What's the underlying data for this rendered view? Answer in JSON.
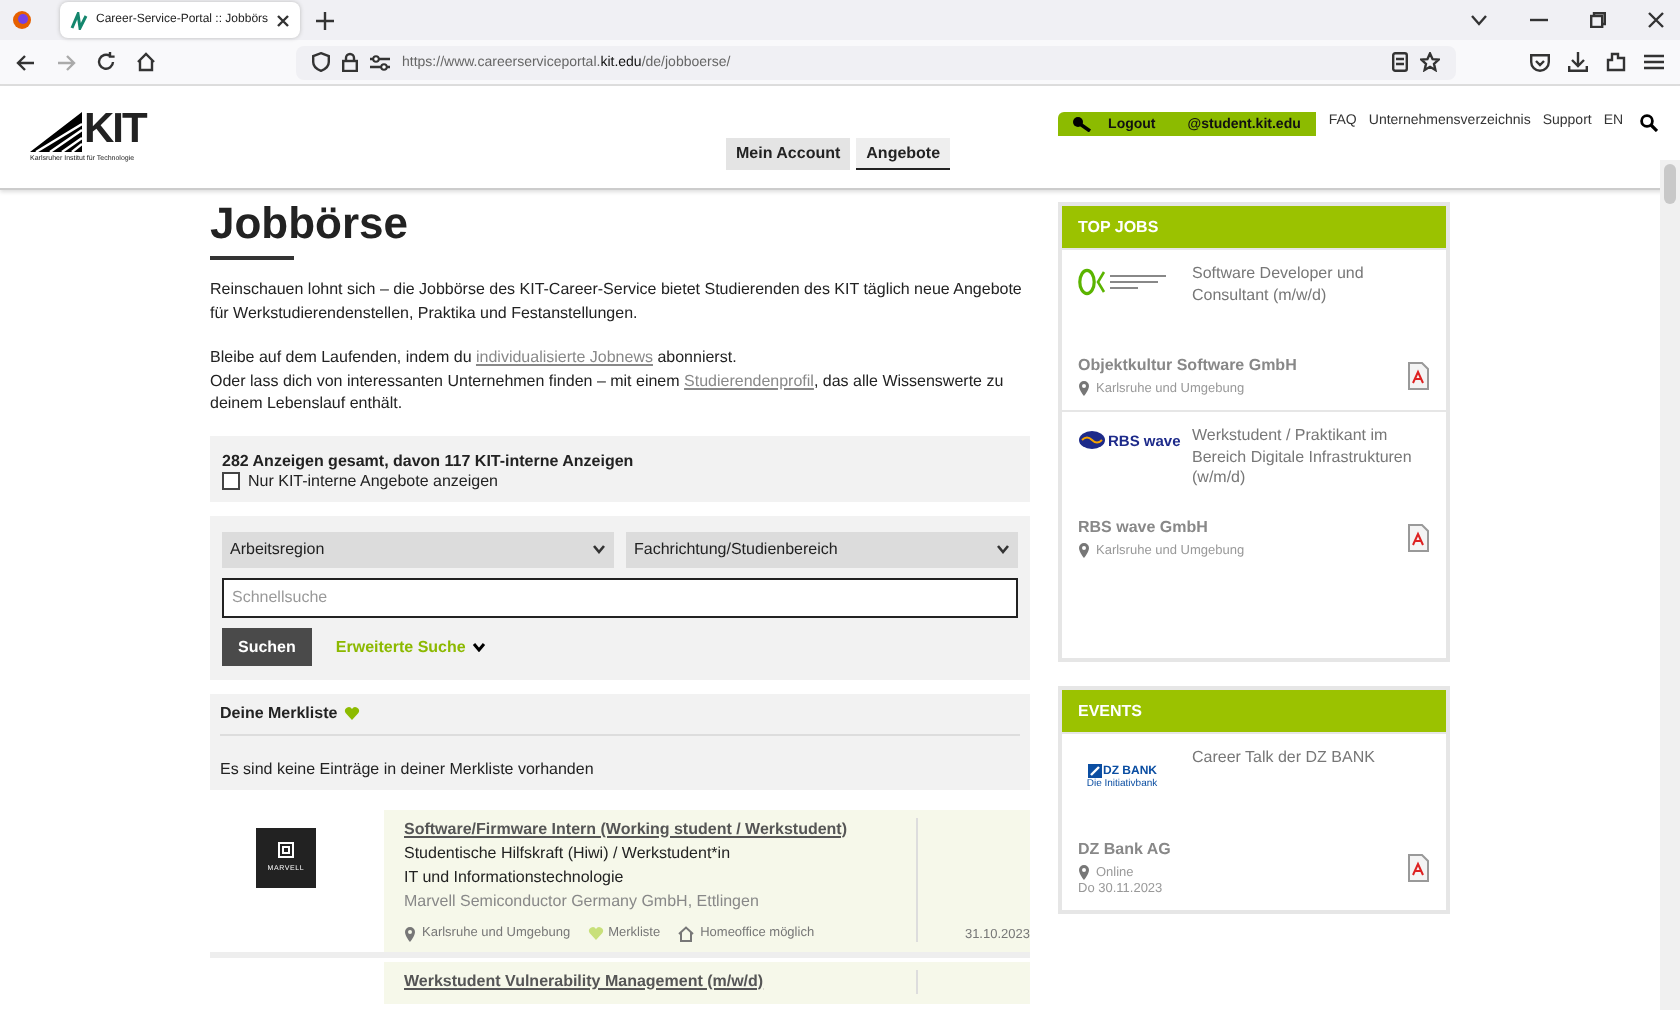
{
  "browser": {
    "tab_title": "Career-Service-Portal :: Jobbörs",
    "url": "https://www.careerserviceportal.**kit.edu**/de/jobboerse/"
  },
  "header": {
    "logo": {
      "wordmark": "KIT",
      "tagline": "Karlsruher Institut für Technologie"
    },
    "account_bar": {
      "logout": "Logout",
      "email": "@student.kit.edu"
    },
    "links": [
      "FAQ",
      "Unternehmensverzeichnis",
      "Support",
      "EN"
    ],
    "nav": [
      {
        "label": "Mein Account",
        "selected": false
      },
      {
        "label": "Angebote",
        "selected": true
      }
    ]
  },
  "intro": {
    "title": "Jobbörse",
    "paragraphs": [
      {
        "lines": [
          [
            {
              "kind": "text",
              "text": "Reinschauen lohnt sich – die Jobbörse des KIT-Career-Service bietet Studierenden des KIT täglich neue Angebote für Werkstudierendenstellen, Praktika und Festanstellungen."
            }
          ]
        ]
      },
      {
        "lines": [
          [
            {
              "kind": "text",
              "text": "Bleibe auf dem Laufenden, indem du "
            },
            {
              "kind": "link",
              "text": "individualisierte Jobnews"
            },
            {
              "kind": "text",
              "text": " abonnierst."
            }
          ],
          [
            {
              "kind": "text",
              "text": "Oder lass dich von interessanten Unternehmen finden – mit einem "
            },
            {
              "kind": "link",
              "text": "Studierendenprofil"
            },
            {
              "kind": "text",
              "text": ", das alle Wissenswerte zu deinem Lebenslauf enthält."
            }
          ]
        ]
      }
    ]
  },
  "stats": {
    "summary": "282 Anzeigen gesamt, davon 117 KIT-interne Anzeigen",
    "filter": {
      "label": "Nur KIT-interne Angebote anzeigen",
      "checked": false
    }
  },
  "search": {
    "selects": [
      "Arbeitsregion",
      "Fachrichtung/Studienbereich"
    ],
    "placeholder": "Schnellsuche",
    "button": "Suchen",
    "advanced": "Erweiterte Suche"
  },
  "watchlist": {
    "title": "Deine Merkliste",
    "empty_text": "Es sind keine Einträge in deiner Merkliste vorhanden"
  },
  "jobs": [
    {
      "logo_text": "MARVELL",
      "title": "Software/Firmware Intern (Working student / Werkstudent)",
      "lines": [
        "Studentische Hilfskraft (Hiwi) / Werkstudent*in",
        "IT und Informationstechnologie"
      ],
      "company": "Marvell Semiconductor Germany GmbH, Ettlingen",
      "location": "Karlsruhe und Umgebung",
      "bookmark": "Merkliste",
      "homeoffice": "Homeoffice möglich",
      "date": "31.10.2023"
    },
    {
      "title": "Werkstudent Vulnerability Management (m/w/d)"
    }
  ],
  "sidebar": [
    {
      "title": "TOP JOBS",
      "items": [
        {
          "logo": {
            "kind": "objektkultur"
          },
          "title": "Software Developer und Consultant (m/w/d)",
          "company": "Objektkultur Software GmbH",
          "location": "Karlsruhe und Umgebung"
        },
        {
          "logo": {
            "kind": "rbs",
            "text": "RBS wave"
          },
          "title": "Werkstudent / Praktikant im Bereich Digitale Infrastrukturen (w/m/d)",
          "company": "RBS wave GmbH",
          "location": "Karlsruhe und Umgebung"
        }
      ]
    },
    {
      "title": "EVENTS",
      "items": [
        {
          "logo": {
            "kind": "dz",
            "text": "DZ BANK",
            "subtext": "Die Initiativbank"
          },
          "title": "Career Talk der DZ BANK",
          "company": "DZ Bank AG",
          "location": "Online",
          "date": "Do 30.11.2023"
        }
      ]
    }
  ]
}
